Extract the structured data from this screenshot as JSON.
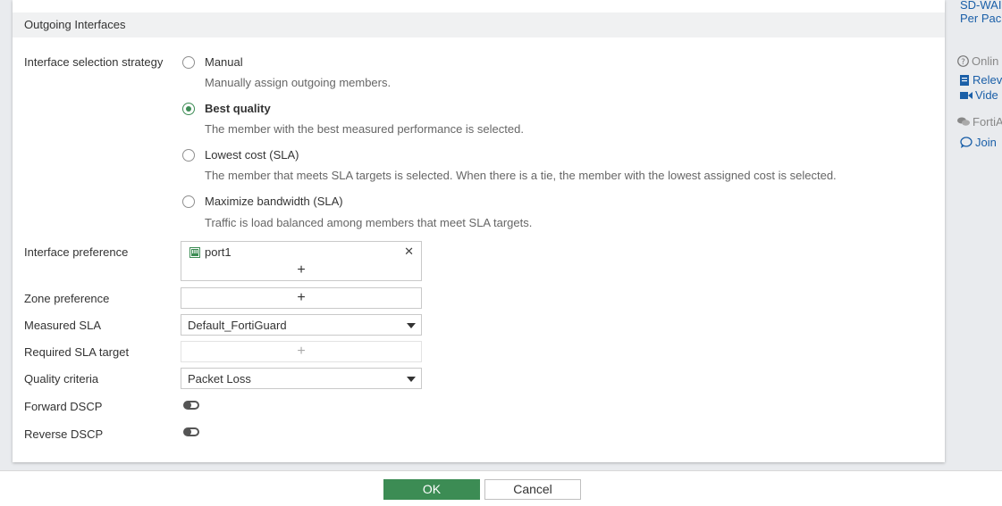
{
  "section": {
    "title": "Outgoing Interfaces"
  },
  "form": {
    "strategy_label": "Interface selection strategy",
    "options": [
      {
        "title": "Manual",
        "desc": "Manually assign outgoing members.",
        "selected": false
      },
      {
        "title": "Best quality",
        "desc": "The member with the best measured performance is selected.",
        "selected": true
      },
      {
        "title": "Lowest cost (SLA)",
        "desc": "The member that meets SLA targets is selected. When there is a tie, the member with the lowest assigned cost is selected.",
        "selected": false
      },
      {
        "title": "Maximize bandwidth (SLA)",
        "desc": "Traffic is load balanced among members that meet SLA targets.",
        "selected": false
      }
    ],
    "interface_pref_label": "Interface preference",
    "interface_pref_items": [
      "port1"
    ],
    "zone_pref_label": "Zone preference",
    "measured_sla_label": "Measured SLA",
    "measured_sla_value": "Default_FortiGuard",
    "required_sla_label": "Required SLA target",
    "quality_criteria_label": "Quality criteria",
    "quality_criteria_value": "Packet Loss",
    "forward_dscp_label": "Forward DSCP",
    "forward_dscp_enabled": false,
    "reverse_dscp_label": "Reverse DSCP",
    "reverse_dscp_enabled": false,
    "add_symbol": "+",
    "remove_symbol": "✕"
  },
  "footer": {
    "ok_label": "OK",
    "cancel_label": "Cancel"
  },
  "sidebar": {
    "top_line1": "SD-WAI",
    "top_line2": "Per Pacl",
    "online_label": "Onlin",
    "relevant_label": "Relev",
    "video_label": "Vide",
    "forti_label": "FortiA",
    "join_label": "Join"
  },
  "colors": {
    "accent": "#3c8c54",
    "link": "#1a5fa8"
  }
}
